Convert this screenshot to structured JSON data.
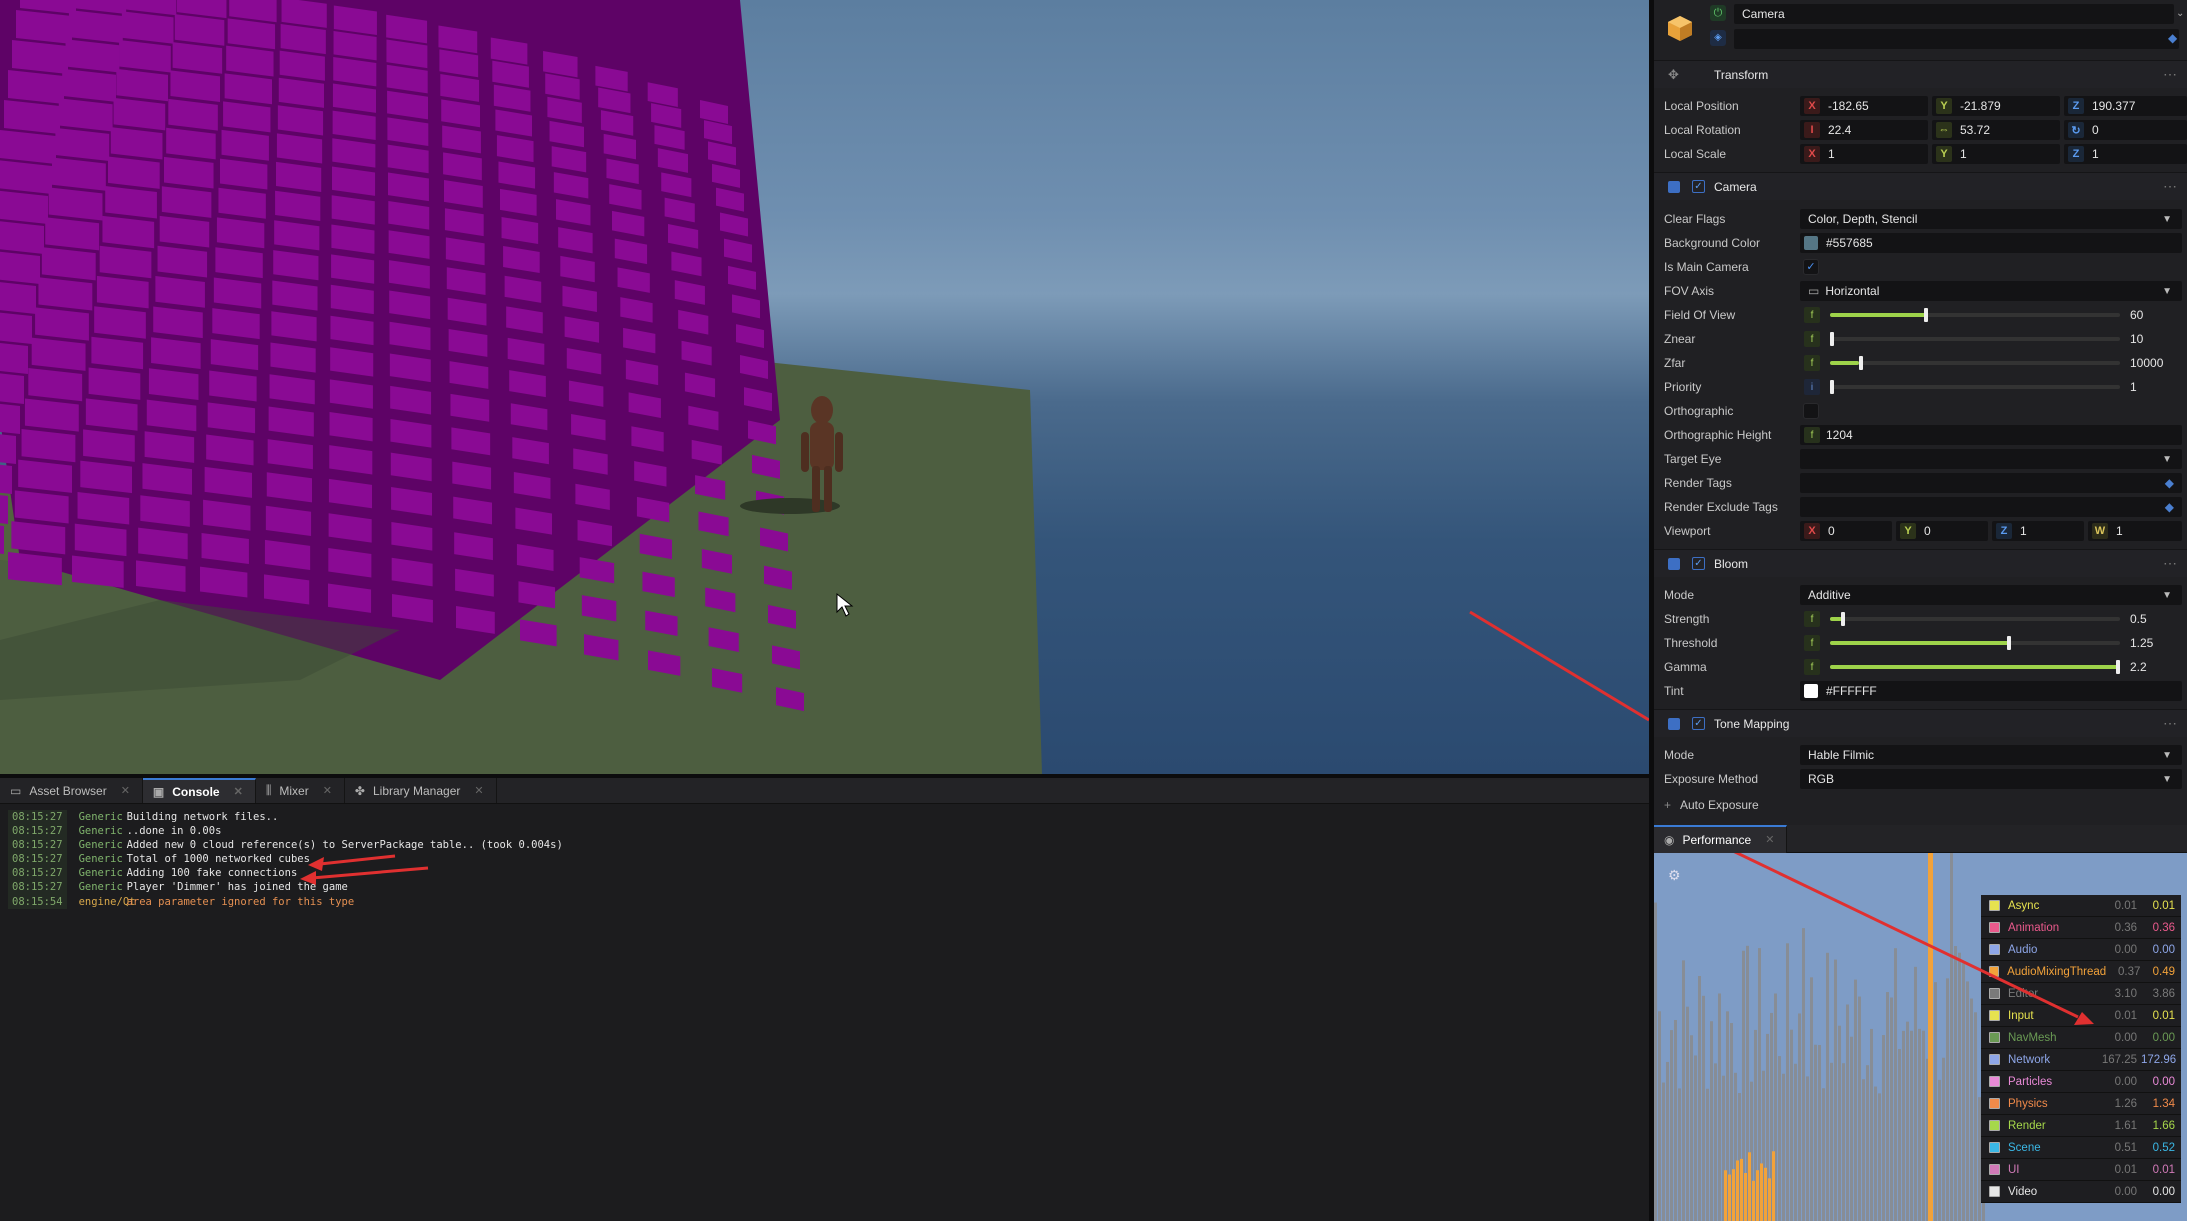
{
  "viewport_colors": {
    "cubes": "#8a0a94",
    "ground": "#4f6040",
    "character": "#5a3525"
  },
  "tabs": [
    {
      "label": "Asset Browser",
      "icon": "folder-icon"
    },
    {
      "label": "Console",
      "icon": "console-icon",
      "active": true
    },
    {
      "label": "Mixer",
      "icon": "mixer-icon"
    },
    {
      "label": "Library Manager",
      "icon": "puzzle-icon"
    }
  ],
  "console": [
    {
      "time": "08:15:27",
      "cat": "Generic",
      "msg": "Building network files.."
    },
    {
      "time": "08:15:27",
      "cat": "Generic",
      "msg": "..done in 0.00s"
    },
    {
      "time": "08:15:27",
      "cat": "Generic",
      "msg": "Added new 0 cloud reference(s) to ServerPackage table.. (took 0.004s)"
    },
    {
      "time": "08:15:27",
      "cat": "Generic",
      "msg": "Total of 1000 networked cubes"
    },
    {
      "time": "08:15:27",
      "cat": "Generic",
      "msg": "Adding 100 fake connections"
    },
    {
      "time": "08:15:27",
      "cat": "Generic",
      "msg": "Player 'Dimmer' has joined the game"
    },
    {
      "time": "08:15:54",
      "cat": "engine/Qt",
      "msg": "area parameter ignored for this type",
      "warn": true
    }
  ],
  "inspector": {
    "object_name": "Camera",
    "transform": {
      "title": "Transform",
      "position_label": "Local Position",
      "pos_x": "-182.65",
      "pos_y": "-21.879",
      "pos_z": "190.377",
      "rotation_label": "Local Rotation",
      "rot_p": "22.4",
      "rot_y": "53.72",
      "rot_r": "0",
      "scale_label": "Local Scale",
      "scl_x": "1",
      "scl_y": "1",
      "scl_z": "1"
    },
    "camera": {
      "title": "Camera",
      "clear_flags_label": "Clear Flags",
      "clear_flags": "Color, Depth, Stencil",
      "bg_label": "Background Color",
      "bg_value": "#557685",
      "bg_color": "#557685",
      "main_label": "Is Main Camera",
      "fov_axis_label": "FOV Axis",
      "fov_axis": "Horizontal",
      "fov_label": "Field Of View",
      "fov": "60",
      "fov_fill": 0.33,
      "znear_label": "Znear",
      "znear": "10",
      "znear_fill": 0.0,
      "zfar_label": "Zfar",
      "zfar": "10000",
      "zfar_fill": 0.1,
      "priority_label": "Priority",
      "priority": "1",
      "priority_fill": 0.0,
      "ortho_label": "Orthographic",
      "ortho_h_label": "Orthographic Height",
      "ortho_h": "1204",
      "target_eye_label": "Target Eye",
      "render_tags_label": "Render Tags",
      "render_excl_label": "Render Exclude Tags",
      "viewport_label": "Viewport",
      "vp_x": "0",
      "vp_y": "0",
      "vp_z": "1",
      "vp_w": "1"
    },
    "bloom": {
      "title": "Bloom",
      "mode_label": "Mode",
      "mode": "Additive",
      "strength_label": "Strength",
      "strength": "0.5",
      "strength_fill": 0.04,
      "threshold_label": "Threshold",
      "threshold": "1.25",
      "threshold_fill": 0.62,
      "gamma_label": "Gamma",
      "gamma": "2.2",
      "gamma_fill": 1.0,
      "tint_label": "Tint",
      "tint": "#FFFFFF",
      "tint_color": "#FFFFFF"
    },
    "tone": {
      "title": "Tone Mapping",
      "mode_label": "Mode",
      "mode": "Hable Filmic",
      "exposure_label": "Exposure Method",
      "exposure": "RGB",
      "auto_label": "Auto Exposure"
    }
  },
  "performance": {
    "tab": "Performance",
    "rows": [
      {
        "name": "Async",
        "a": "0.01",
        "b": "0.01",
        "color": "#e7e34f"
      },
      {
        "name": "Animation",
        "a": "0.36",
        "b": "0.36",
        "color": "#ea5a8c"
      },
      {
        "name": "Audio",
        "a": "0.00",
        "b": "0.00",
        "color": "#8ea6e8"
      },
      {
        "name": "AudioMixingThread",
        "a": "0.37",
        "b": "0.49",
        "color": "#f2a23a"
      },
      {
        "name": "Editor",
        "a": "3.10",
        "b": "3.86",
        "color": "#7a7a7a"
      },
      {
        "name": "Input",
        "a": "0.01",
        "b": "0.01",
        "color": "#e7e34f"
      },
      {
        "name": "NavMesh",
        "a": "0.00",
        "b": "0.00",
        "color": "#6a9a54"
      },
      {
        "name": "Network",
        "a": "167.25",
        "b": "172.96",
        "color": "#8ea6e8"
      },
      {
        "name": "Particles",
        "a": "0.00",
        "b": "0.00",
        "color": "#e98ad7"
      },
      {
        "name": "Physics",
        "a": "1.26",
        "b": "1.34",
        "color": "#f08a4a"
      },
      {
        "name": "Render",
        "a": "1.61",
        "b": "1.66",
        "color": "#a6d84a"
      },
      {
        "name": "Scene",
        "a": "0.51",
        "b": "0.52",
        "color": "#3bb8e6"
      },
      {
        "name": "UI",
        "a": "0.01",
        "b": "0.01",
        "color": "#d17ab8"
      },
      {
        "name": "Video",
        "a": "0.00",
        "b": "0.00",
        "color": "#e6e6e6"
      }
    ]
  }
}
